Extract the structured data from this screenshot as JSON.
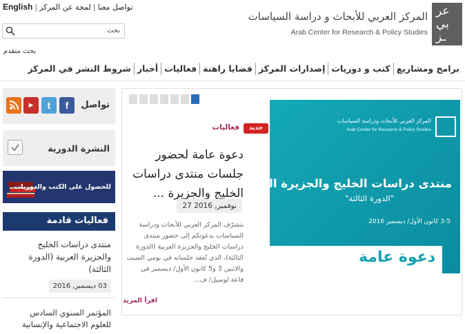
{
  "top_links": {
    "english": "English",
    "contact": "تواصل معنا",
    "about": "لمحة عن المركز",
    "separator": "|"
  },
  "search": {
    "placeholder": "بحث",
    "advanced": "بحث متقدم"
  },
  "logo": {
    "ar": "المركز العربي للأبحاث و دراسة السياسات",
    "en": "Arab Center for Research & Policy Studies",
    "mark_top": "عر",
    "mark_mid": "بي",
    "mark_bot": "ـز"
  },
  "nav": {
    "items": [
      "برامج ومشاريع",
      "كتب و دوريات",
      "إصدارات المركز",
      "قضايا راهنة",
      "فعاليات",
      "أخبار",
      "شروط النشر في المركز"
    ]
  },
  "social": {
    "title": "تواصل",
    "icons": [
      "facebook-icon",
      "twitter-icon",
      "youtube-icon",
      "rss-icon"
    ]
  },
  "newsletter": {
    "title": "النشرة الدورية"
  },
  "books_banner": {
    "text": "للحصول على الكتب والدوريات"
  },
  "events": {
    "header": "فعاليات قادمة",
    "items": [
      {
        "title": "منتدى دراسات الخليج والجزيرة العربية (الدورة الثالثة)",
        "date": "03 ديسمبر, 2016"
      },
      {
        "title": "المؤتمر السنوي السادس للعلوم الاجتماعية والإنسانية"
      }
    ]
  },
  "feature": {
    "category": "فعاليات",
    "badge": "جديد",
    "title": "دعوة عامة لحضور جلسات منتدى دراسات الخليج والجزيرة ...",
    "date": "27 نوفمبر, 2016",
    "body": "يتشرّف المركز العربي للأبحاث ودراسة السياسات بدعوتكم إلى حضور منتدى دراسات الخليج والجزيرة العربية (الدورة الثالثة)، الذي تُعقد جلساته في يومي السبت والاثنين 3 و5 كانون الأول/ ديسمبر في قاعة لوسيل/ ف...",
    "more": "اقرأ المزيد",
    "slides_total": 7,
    "slide_active": 7
  },
  "poster": {
    "logo_ar": "المركز العربي للأبحاث ودراسة السياسات",
    "logo_en": "Arab Center for Research & Policy Studies",
    "heading": "منتدى دراسات الخليج والجزيرة العربية",
    "subheading": "\"الدورة الثالثة\"",
    "dates": "3-5 كانون الأول/ ديسمبر 2016",
    "callout": "دعوة عامة"
  },
  "colors": {
    "navy": "#1b3a70",
    "teal": "#0e97a8",
    "accent": "#a0255e",
    "badge_red": "#d42222",
    "slider_active": "#2a6db5"
  }
}
